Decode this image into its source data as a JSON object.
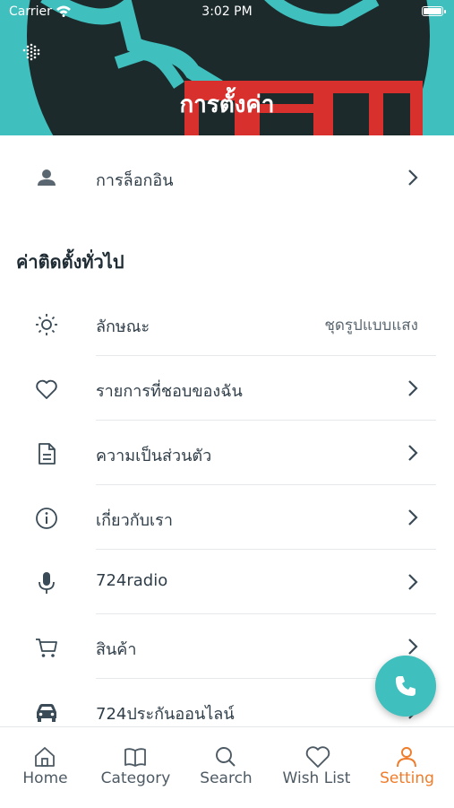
{
  "status_bar": {
    "carrier": "Carrier",
    "time": "3:02 PM"
  },
  "header": {
    "title": "การตั้งค่า"
  },
  "login": {
    "label": "การล็อกอิน"
  },
  "section": {
    "title": "ค่าติดตั้งทั่วไป"
  },
  "settings": [
    {
      "label": "ลักษณะ",
      "value": "ชุดรูปแบบแสง",
      "icon": "sun-icon"
    },
    {
      "label": "รายการที่ชอบของฉัน",
      "icon": "heart-icon"
    },
    {
      "label": "ความเป็นส่วนตัว",
      "icon": "document-icon"
    },
    {
      "label": "เกี่ยวกับเรา",
      "icon": "info-icon"
    },
    {
      "label": "724radio",
      "icon": "microphone-icon"
    },
    {
      "label": "สินค้า",
      "icon": "cart-icon"
    },
    {
      "label": "724ประกันออนไลน์",
      "icon": "car-icon"
    }
  ],
  "fab": {
    "icon": "phone-icon"
  },
  "tabs": [
    {
      "label": "Home",
      "icon": "home-icon"
    },
    {
      "label": "Category",
      "icon": "book-icon"
    },
    {
      "label": "Search",
      "icon": "search-icon"
    },
    {
      "label": "Wish List",
      "icon": "heart-icon"
    },
    {
      "label": "Setting",
      "icon": "person-icon",
      "active": true
    }
  ],
  "colors": {
    "accent": "#3fbfbd",
    "active_tab": "#f07c2a",
    "text": "#2f3d48",
    "header_dark": "#1c2a2c",
    "header_red": "#d8302d"
  }
}
